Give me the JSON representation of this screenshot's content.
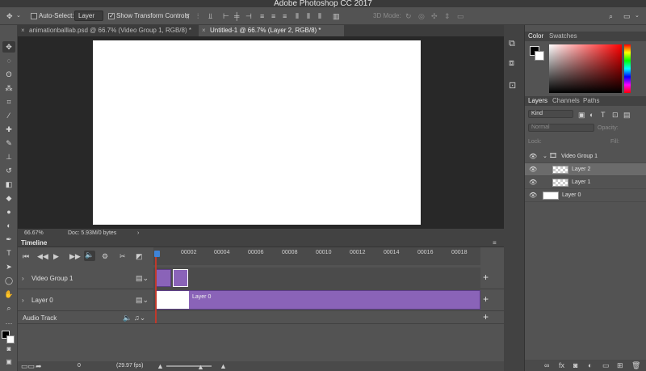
{
  "app": {
    "title": "Adobe Photoshop CC 2017"
  },
  "options_bar": {
    "auto_select_label": "Auto-Select:",
    "auto_select_value": "Layer",
    "show_transform_label": "Show Transform Controls",
    "mode_3d_label": "3D Mode:"
  },
  "tabs": [
    {
      "label": "animationballlab.psd @ 66.7% (Video Group 1, RGB/8) *",
      "active": false
    },
    {
      "label": "Untitled-1 @ 66.7% (Layer 2, RGB/8) *",
      "active": true
    }
  ],
  "status": {
    "zoom": "66.67%",
    "doc": "Doc: 5.93M/0 bytes"
  },
  "timeline": {
    "title": "Timeline",
    "ticks": [
      "00002",
      "00004",
      "00006",
      "00008",
      "00010",
      "00012",
      "00014",
      "00016",
      "00018"
    ],
    "tracks": [
      {
        "name": "Video Group 1"
      },
      {
        "name": "Layer 0",
        "clip_label": "Layer 0"
      },
      {
        "name": "Audio Track"
      }
    ],
    "bottom": {
      "frame": "0",
      "fps": "(29.97 fps)"
    }
  },
  "right_panel": {
    "color_tabs": [
      "Color",
      "Swatches"
    ],
    "layers_tabs": [
      "Layers",
      "Channels",
      "Paths"
    ],
    "kind_label": "Kind",
    "blend_mode": "Normal",
    "opacity_label": "Opacity:",
    "lock_label": "Lock:",
    "fill_label": "Fill:",
    "layers": [
      {
        "name": "Video Group 1",
        "type": "group"
      },
      {
        "name": "Layer 2",
        "selected": true
      },
      {
        "name": "Layer 1"
      },
      {
        "name": "Layer 0"
      }
    ]
  },
  "colors": {
    "accent_clip": "#8a63b8",
    "playhead": "#3f84d8",
    "playline": "#c0392b"
  }
}
